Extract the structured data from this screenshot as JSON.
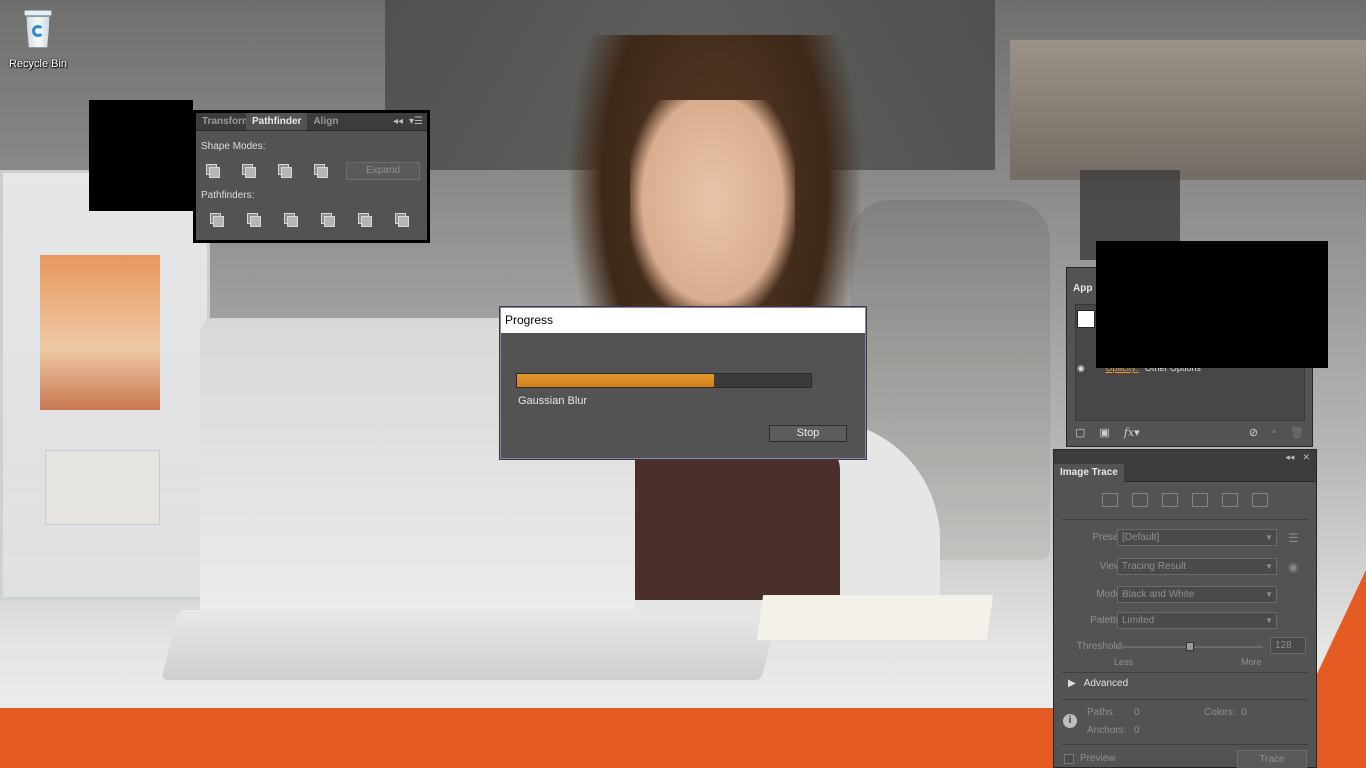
{
  "desktop": {
    "recycle_bin_label": "Recycle Bin",
    "icon": "recycle-bin-icon"
  },
  "pathfinder_panel": {
    "tabs": [
      "Transform",
      "Pathfinder",
      "Align"
    ],
    "active_tab": "Pathfinder",
    "shape_modes_label": "Shape Modes:",
    "pathfinders_label": "Pathfinders:",
    "expand_label": "Expand",
    "shape_mode_icons": [
      "unite-icon",
      "minus-front-icon",
      "intersect-icon",
      "exclude-icon"
    ],
    "pathfinder_icons": [
      "divide-icon",
      "trim-icon",
      "merge-icon",
      "crop-icon",
      "outline-icon",
      "minus-back-icon"
    ]
  },
  "progress_dialog": {
    "title": "Progress",
    "caption": "Gaussian Blur",
    "progress": 0.67,
    "stop_label": "Stop",
    "accent": "#d98a26"
  },
  "appearance_panel": {
    "tab_label": "App",
    "opacity_label": "Opacity:",
    "opacity_value": "Other Options"
  },
  "image_trace_panel": {
    "title": "Image Trace",
    "preset_label": "Preset:",
    "preset_value": "[Default]",
    "view_label": "View:",
    "view_value": "Tracing Result",
    "mode_label": "Mode:",
    "mode_value": "Black and White",
    "palette_label": "Palette:",
    "palette_value": "Limited",
    "threshold_label": "Threshold:",
    "threshold_value": "128",
    "threshold_fraction": 0.5,
    "less_label": "Less",
    "more_label": "More",
    "advanced_label": "Advanced",
    "paths_label": "Paths:",
    "paths_value": "0",
    "anchors_label": "Anchors:",
    "anchors_value": "0",
    "colors_label": "Colors:",
    "colors_value": "0",
    "preview_label": "Preview",
    "trace_label": "Trace"
  },
  "colors": {
    "panel_bg": "#535353",
    "orange_brand": "#e45b23"
  }
}
